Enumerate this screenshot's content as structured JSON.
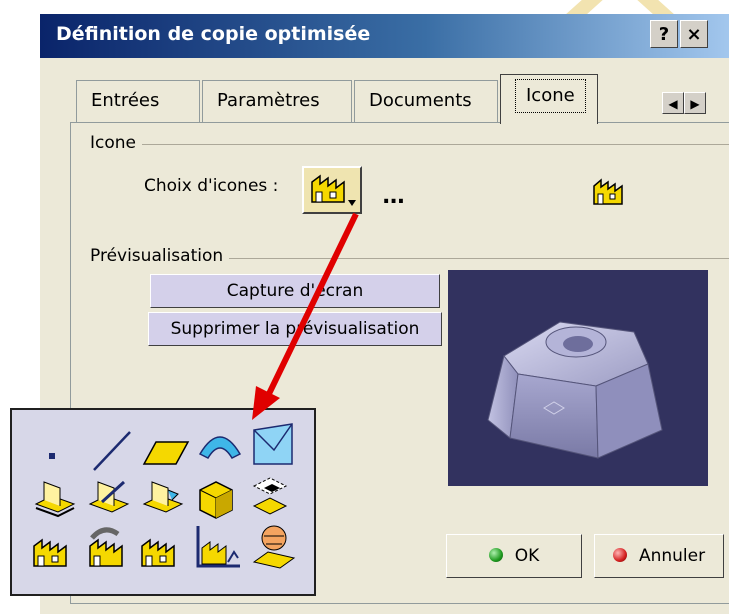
{
  "window": {
    "title": "Définition de copie optimisée",
    "help_label": "?",
    "close_label": "×"
  },
  "tabs": [
    {
      "label": "Entrées",
      "selected": false
    },
    {
      "label": "Paramètres",
      "selected": false
    },
    {
      "label": "Documents",
      "selected": false
    },
    {
      "label": "Icone",
      "selected": true
    }
  ],
  "icon_group": {
    "label": "Icone",
    "choice_label": "Choix d'icones :",
    "more_label": "...",
    "icon": "factory-icon"
  },
  "preview_group": {
    "label": "Prévisualisation",
    "capture_label": "Capture d'écran",
    "delete_label": "Supprimer la prévisualisation"
  },
  "footer": {
    "ok_label": "OK",
    "cancel_label": "Annuler"
  },
  "palette": {
    "rows": [
      [
        "point-icon",
        "line-icon",
        "plane-icon",
        "surface-icon",
        "envelope-icon"
      ],
      [
        "sketch-icon",
        "sketch-edit-icon",
        "sketch-profile-icon",
        "cube-icon",
        "assembly-icon"
      ],
      [
        "factory-icon",
        "factory-rotate-icon",
        "factory-icon",
        "factory-chart-icon",
        "map-icon"
      ]
    ]
  },
  "colors": {
    "titlebar": "#0a246a",
    "preview_bg": "#32325f",
    "annotation_arrow": "#e00000",
    "ok_ball": "#1f9a1f",
    "cancel_ball": "#d42020"
  }
}
